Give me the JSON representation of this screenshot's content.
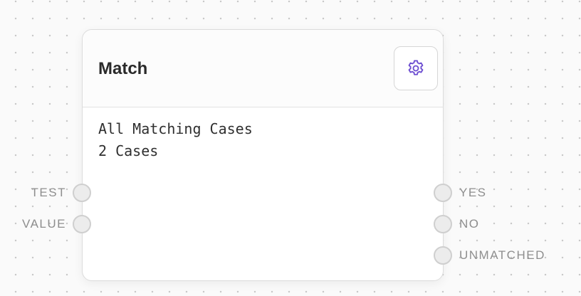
{
  "node": {
    "title": "Match",
    "settings_icon": "gear-icon",
    "accent_color": "#6d4ed1",
    "body_lines": [
      "All Matching Cases",
      "2 Cases"
    ]
  },
  "inputs": [
    {
      "label": "TEST"
    },
    {
      "label": "VALUE"
    }
  ],
  "outputs": [
    {
      "label": "YES"
    },
    {
      "label": "NO"
    },
    {
      "label": "UNMATCHED"
    }
  ]
}
